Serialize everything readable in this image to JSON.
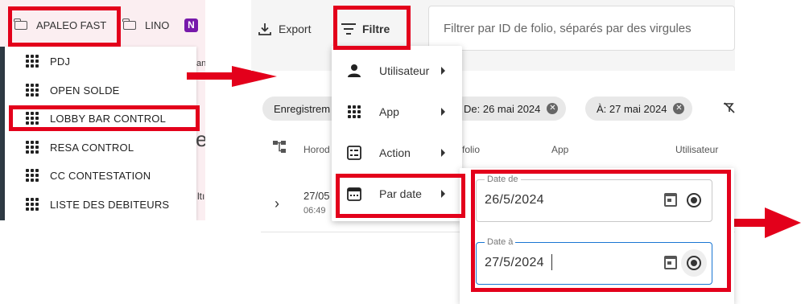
{
  "bookmarks": {
    "folders": [
      {
        "label": "APALEO FAST"
      },
      {
        "label": "LINO"
      }
    ],
    "onenote_letter": "N",
    "menu_items": [
      {
        "label": "PDJ"
      },
      {
        "label": "OPEN SOLDE"
      },
      {
        "label": "LOBBY BAR CONTROL"
      },
      {
        "label": "RESA CONTROL"
      },
      {
        "label": "CC CONTESTATION"
      },
      {
        "label": "LISTE DES DEBITEURS"
      }
    ]
  },
  "toolbar": {
    "export_label": "Export",
    "filter_label": "Filtre",
    "search_placeholder": "Filtrer par ID de folio, séparés par des virgules"
  },
  "chips": {
    "partial_label": "Enregistrem",
    "from_label": "De: 26 mai 2024",
    "to_label": "À: 27 mai 2024"
  },
  "table": {
    "headers": {
      "horodatage": "Horod",
      "folio": "folio",
      "app": "App",
      "user": "Utilisateur"
    },
    "row": {
      "date": "27/05",
      "time": "06:49"
    }
  },
  "filter_menu": {
    "items": [
      {
        "label": "Utilisateur",
        "icon": "person-icon"
      },
      {
        "label": "App",
        "icon": "apps-grid-icon"
      },
      {
        "label": "Action",
        "icon": "list-box-icon"
      },
      {
        "label": "Par date",
        "icon": "calendar-icon"
      }
    ]
  },
  "date_filter": {
    "from": {
      "legend": "Date de",
      "value": "26/5/2024"
    },
    "to": {
      "legend": "Date à",
      "value": "27/5/2024"
    }
  },
  "background_glimpses": {
    "left_char_1": "e",
    "left_text_1": "ltı",
    "left_text_2": "an"
  },
  "annotation_colors": {
    "highlight": "#e3001b"
  }
}
